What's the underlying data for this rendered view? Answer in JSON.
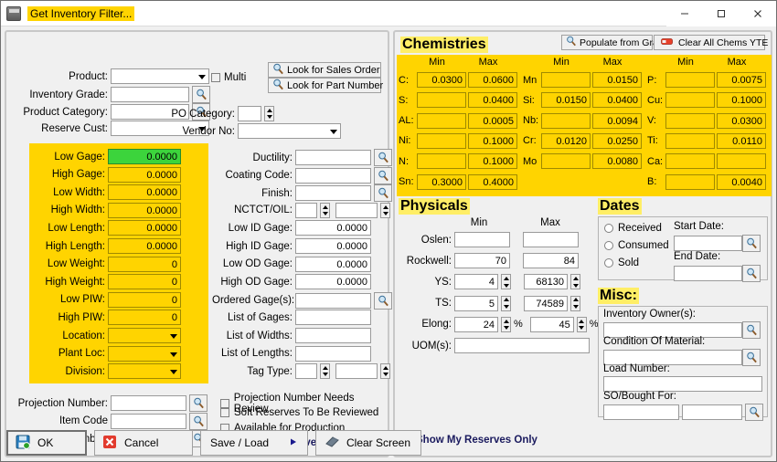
{
  "window": {
    "title": "Get Inventory Filter...",
    "minimize": "─",
    "maximize": "□",
    "close": "✕"
  },
  "left": {
    "top_fields": [
      {
        "label": "Product:",
        "value": "",
        "type": "combo"
      },
      {
        "label": "Inventory Grade:",
        "value": "",
        "type": "lookup"
      },
      {
        "label": "Product Category:",
        "value": "",
        "type": "lookup"
      },
      {
        "label": "Reserve Cust:",
        "value": "",
        "type": "combo"
      }
    ],
    "multi_checkbox": "Multi",
    "buttons": {
      "look_sales_order": "Look for Sales Order",
      "look_part_number": "Look for Part Number"
    },
    "po_category": {
      "label": "PO Category:",
      "value": ""
    },
    "vendor_no": {
      "label": "Vendor No:",
      "value": ""
    },
    "yellow_fields": [
      {
        "label": "Low Gage:",
        "value": "0.0000",
        "type": "num",
        "focused": true
      },
      {
        "label": "High Gage:",
        "value": "0.0000",
        "type": "num"
      },
      {
        "label": "Low Width:",
        "value": "0.0000",
        "type": "num"
      },
      {
        "label": "High Width:",
        "value": "0.0000",
        "type": "num"
      },
      {
        "label": "Low Length:",
        "value": "0.0000",
        "type": "num"
      },
      {
        "label": "High Length:",
        "value": "0.0000",
        "type": "num"
      },
      {
        "label": "Low Weight:",
        "value": "0",
        "type": "num"
      },
      {
        "label": "High Weight:",
        "value": "0",
        "type": "num"
      },
      {
        "label": "Low PIW:",
        "value": "0",
        "type": "num"
      },
      {
        "label": "High PIW:",
        "value": "0",
        "type": "num"
      },
      {
        "label": "Location:",
        "value": "",
        "type": "combo"
      },
      {
        "label": "Plant Loc:",
        "value": "",
        "type": "combo"
      },
      {
        "label": "Division:",
        "value": "",
        "type": "combo"
      }
    ],
    "mid_fields": [
      {
        "label": "Ductility:",
        "value": "",
        "type": "lookup"
      },
      {
        "label": "Coating Code:",
        "value": "",
        "type": "lookup"
      },
      {
        "label": "Finish:",
        "value": "",
        "type": "lookup"
      },
      {
        "label": "NCTCT/OIL:",
        "value": "",
        "value2": "",
        "type": "spin2"
      },
      {
        "label": "Low ID Gage:",
        "value": "0.0000",
        "type": "num"
      },
      {
        "label": "High ID Gage:",
        "value": "0.0000",
        "type": "num"
      },
      {
        "label": "Low OD Gage:",
        "value": "0.0000",
        "type": "num"
      },
      {
        "label": "High OD Gage:",
        "value": "0.0000",
        "type": "num"
      },
      {
        "label": "Ordered Gage(s):",
        "value": "",
        "type": "lookup"
      },
      {
        "label": "List of Gages:",
        "value": "",
        "type": "text"
      },
      {
        "label": "List of Widths:",
        "value": "",
        "type": "text"
      },
      {
        "label": "List of Lengths:",
        "value": "",
        "type": "text"
      },
      {
        "label": "Tag Type:",
        "value": "",
        "value2": "",
        "type": "spin2"
      }
    ],
    "bottom_fields": [
      {
        "label": "Projection Number:",
        "value": ""
      },
      {
        "label": "Item Code",
        "value": ""
      },
      {
        "label": "Part Number:",
        "value": ""
      }
    ],
    "checkboxes": [
      {
        "label": "Projection Number Needs Review",
        "checked": false,
        "bold": false
      },
      {
        "label": "Soft Reserves To Be Reviewed",
        "checked": false,
        "bold": false
      },
      {
        "label": "Available for Production",
        "checked": false,
        "bold": false
      },
      {
        "label": "Show Unreserved Only",
        "checked": false,
        "bold": true
      }
    ],
    "collapse_button": "<<<"
  },
  "chemistries": {
    "title": "Chemistries",
    "populate_button": "Populate from Grade",
    "clear_button": "Clear All Chems YTE",
    "col_headers": [
      "Min",
      "Max"
    ],
    "columns": [
      {
        "rows": [
          {
            "element": "C:",
            "min": "0.0300",
            "max": "0.0600"
          },
          {
            "element": "S:",
            "min": "",
            "max": "0.0400"
          },
          {
            "element": "AL:",
            "min": "",
            "max": "0.0005"
          },
          {
            "element": "Ni:",
            "min": "",
            "max": "0.1000"
          },
          {
            "element": "N:",
            "min": "",
            "max": "0.1000"
          },
          {
            "element": "Sn:",
            "min": "0.3000",
            "max": "0.4000"
          }
        ]
      },
      {
        "rows": [
          {
            "element": "Mn",
            "min": "",
            "max": "0.0150"
          },
          {
            "element": "Si:",
            "min": "0.0150",
            "max": "0.0400"
          },
          {
            "element": "Nb:",
            "min": "",
            "max": "0.0094"
          },
          {
            "element": "Cr:",
            "min": "0.0120",
            "max": "0.0250"
          },
          {
            "element": "Mo",
            "min": "",
            "max": "0.0080"
          },
          {
            "element": "",
            "min": null,
            "max": null
          }
        ]
      },
      {
        "rows": [
          {
            "element": "P:",
            "min": "",
            "max": "0.0075"
          },
          {
            "element": "Cu:",
            "min": "",
            "max": "0.1000"
          },
          {
            "element": "V:",
            "min": "",
            "max": "0.0300"
          },
          {
            "element": "Ti:",
            "min": "",
            "max": "0.0110"
          },
          {
            "element": "Ca:",
            "min": "",
            "max": ""
          },
          {
            "element": "B:",
            "min": "",
            "max": "0.0040"
          }
        ]
      }
    ]
  },
  "physicals": {
    "title": "Physicals",
    "col_headers": [
      "Min",
      "Max"
    ],
    "rows": [
      {
        "label": "Oslen:",
        "min": "",
        "max": "",
        "type": "text",
        "suffix": ""
      },
      {
        "label": "Rockwell:",
        "min": "70",
        "max": "84",
        "type": "text",
        "suffix": ""
      },
      {
        "label": "YS:",
        "min": "4",
        "max": "68130",
        "type": "spin",
        "suffix": ""
      },
      {
        "label": "TS:",
        "min": "5",
        "max": "74589",
        "type": "spin",
        "suffix": ""
      },
      {
        "label": "Elong:",
        "min": "24",
        "max": "45",
        "type": "spin",
        "suffix": "%"
      }
    ],
    "uom": {
      "label": "UOM(s):",
      "value": ""
    }
  },
  "dates": {
    "title": "Dates",
    "radios": [
      {
        "label": "Received",
        "selected": false
      },
      {
        "label": "Consumed",
        "selected": false
      },
      {
        "label": "Sold",
        "selected": false
      }
    ],
    "start_date": {
      "label": "Start Date:",
      "value": ""
    },
    "end_date": {
      "label": "End Date:",
      "value": ""
    }
  },
  "misc": {
    "title": "Misc:",
    "fields": [
      {
        "label": "Inventory Owner(s):",
        "value": "",
        "lookup": true
      },
      {
        "label": "Condition Of Material:",
        "value": "",
        "lookup": true
      },
      {
        "label": "Load Number:",
        "value": "",
        "lookup": false
      }
    ],
    "so_bought": {
      "label": "SO/Bought For:",
      "value": "",
      "value2": ""
    }
  },
  "show_my_reserves": "Show My Reserves Only",
  "footer": {
    "ok": "OK",
    "cancel": "Cancel",
    "save_load": "Save / Load",
    "clear_screen": "Clear Screen"
  }
}
